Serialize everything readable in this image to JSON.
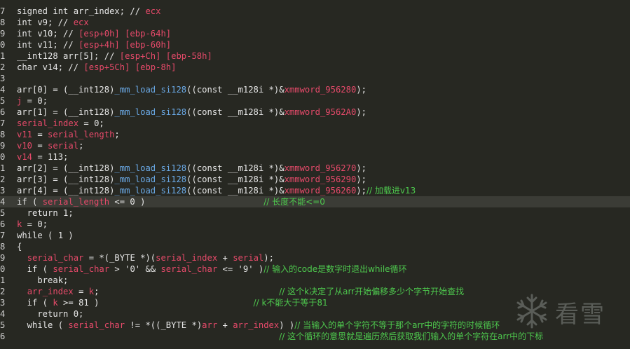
{
  "editor": {
    "lines": [
      {
        "ln": "7",
        "hl": false,
        "tokens": [
          {
            "t": "signed int arr_index; // "
          },
          {
            "t": "ecx",
            "c": "cmt"
          }
        ]
      },
      {
        "ln": "8",
        "hl": false,
        "tokens": [
          {
            "t": "int v9; // "
          },
          {
            "t": "ecx",
            "c": "cmt"
          }
        ]
      },
      {
        "ln": "9",
        "hl": false,
        "tokens": [
          {
            "t": "int v10; // "
          },
          {
            "t": "[esp+0h] [ebp-64h]",
            "c": "cmt"
          }
        ]
      },
      {
        "ln": "0",
        "hl": false,
        "tokens": [
          {
            "t": "int v11; // "
          },
          {
            "t": "[esp+4h] [ebp-60h]",
            "c": "cmt"
          }
        ]
      },
      {
        "ln": "1",
        "hl": false,
        "tokens": [
          {
            "t": "__int128 arr[5]; // "
          },
          {
            "t": "[esp+Ch] [ebp-58h]",
            "c": "cmt"
          }
        ]
      },
      {
        "ln": "2",
        "hl": false,
        "tokens": [
          {
            "t": "char v14; // "
          },
          {
            "t": "[esp+5Ch] [ebp-8h]",
            "c": "cmt"
          }
        ]
      },
      {
        "ln": "3",
        "hl": false,
        "tokens": []
      },
      {
        "ln": "4",
        "hl": false,
        "tokens": [
          {
            "t": "arr[0] = (__int128)"
          },
          {
            "t": "_mm_load_si128",
            "c": "fn"
          },
          {
            "t": "((const __m128i *)&"
          },
          {
            "t": "xmmword_956280",
            "c": "var"
          },
          {
            "t": ");"
          }
        ]
      },
      {
        "ln": "5",
        "hl": false,
        "tokens": [
          {
            "t": "j",
            "c": "var"
          },
          {
            "t": " = 0;"
          }
        ]
      },
      {
        "ln": "6",
        "hl": false,
        "tokens": [
          {
            "t": "arr[1] = (__int128)"
          },
          {
            "t": "_mm_load_si128",
            "c": "fn"
          },
          {
            "t": "((const __m128i *)&"
          },
          {
            "t": "xmmword_9562A0",
            "c": "var"
          },
          {
            "t": ");"
          }
        ]
      },
      {
        "ln": "7",
        "hl": false,
        "tokens": [
          {
            "t": "serial_index",
            "c": "var"
          },
          {
            "t": " = 0;"
          }
        ]
      },
      {
        "ln": "8",
        "hl": false,
        "tokens": [
          {
            "t": "v11",
            "c": "var"
          },
          {
            "t": " = "
          },
          {
            "t": "serial_length",
            "c": "var"
          },
          {
            "t": ";"
          }
        ]
      },
      {
        "ln": "9",
        "hl": false,
        "tokens": [
          {
            "t": "v10",
            "c": "var"
          },
          {
            "t": " = "
          },
          {
            "t": "serial",
            "c": "var"
          },
          {
            "t": ";"
          }
        ]
      },
      {
        "ln": "0",
        "hl": false,
        "tokens": [
          {
            "t": "v14",
            "c": "var"
          },
          {
            "t": " = 113;"
          }
        ]
      },
      {
        "ln": "1",
        "hl": false,
        "tokens": [
          {
            "t": "arr[2] = (__int128)"
          },
          {
            "t": "_mm_load_si128",
            "c": "fn"
          },
          {
            "t": "((const __m128i *)&"
          },
          {
            "t": "xmmword_956270",
            "c": "var"
          },
          {
            "t": ");"
          }
        ]
      },
      {
        "ln": "2",
        "hl": false,
        "tokens": [
          {
            "t": "arr[3] = (__int128)"
          },
          {
            "t": "_mm_load_si128",
            "c": "fn"
          },
          {
            "t": "((const __m128i *)&"
          },
          {
            "t": "xmmword_956290",
            "c": "var"
          },
          {
            "t": ");"
          }
        ]
      },
      {
        "ln": "3",
        "hl": false,
        "tokens": [
          {
            "t": "arr[4] = (__int128)"
          },
          {
            "t": "_mm_load_si128",
            "c": "fn"
          },
          {
            "t": "((const __m128i *)&"
          },
          {
            "t": "xmmword_956260",
            "c": "var"
          },
          {
            "t": ");"
          },
          {
            "t": "// 加载进v13",
            "c": "zh"
          }
        ]
      },
      {
        "ln": "4",
        "hl": true,
        "tokens": [
          {
            "t": "if ( "
          },
          {
            "t": "serial_length",
            "c": "var"
          },
          {
            "t": " <= 0 )                       "
          },
          {
            "t": "// 长度不能<=0",
            "c": "zh"
          }
        ]
      },
      {
        "ln": "5",
        "hl": false,
        "tokens": [
          {
            "t": "  return 1;"
          }
        ]
      },
      {
        "ln": "6",
        "hl": false,
        "tokens": [
          {
            "t": "k",
            "c": "var"
          },
          {
            "t": " = 0;"
          }
        ]
      },
      {
        "ln": "7",
        "hl": false,
        "tokens": [
          {
            "t": "while ( 1 )"
          }
        ]
      },
      {
        "ln": "8",
        "hl": false,
        "tokens": [
          {
            "t": "{"
          }
        ]
      },
      {
        "ln": "9",
        "hl": false,
        "tokens": [
          {
            "t": "  "
          },
          {
            "t": "serial_char",
            "c": "var"
          },
          {
            "t": " = *(_BYTE *)("
          },
          {
            "t": "serial_index",
            "c": "var"
          },
          {
            "t": " + "
          },
          {
            "t": "serial",
            "c": "var"
          },
          {
            "t": ");"
          }
        ]
      },
      {
        "ln": "0",
        "hl": false,
        "tokens": [
          {
            "t": "  if ( "
          },
          {
            "t": "serial_char",
            "c": "var"
          },
          {
            "t": " > '0' && "
          },
          {
            "t": "serial_char",
            "c": "var"
          },
          {
            "t": " <= '9' )"
          },
          {
            "t": "// 输入的code是数字时退出while循环",
            "c": "zh"
          }
        ]
      },
      {
        "ln": "1",
        "hl": false,
        "tokens": [
          {
            "t": "    break;"
          }
        ]
      },
      {
        "ln": "2",
        "hl": false,
        "tokens": [
          {
            "t": "  "
          },
          {
            "t": "arr_index",
            "c": "var"
          },
          {
            "t": " = "
          },
          {
            "t": "k",
            "c": "var"
          },
          {
            "t": ";                                   "
          },
          {
            "t": "// 这个k决定了从arr开始偏移多少个字节开始查找",
            "c": "zh"
          }
        ]
      },
      {
        "ln": "3",
        "hl": false,
        "tokens": [
          {
            "t": "  if ( "
          },
          {
            "t": "k",
            "c": "var"
          },
          {
            "t": " >= 81 )                              "
          },
          {
            "t": "// k不能大于等于81",
            "c": "zh"
          }
        ]
      },
      {
        "ln": "4",
        "hl": false,
        "tokens": [
          {
            "t": "    return 0;"
          }
        ]
      },
      {
        "ln": "5",
        "hl": false,
        "tokens": [
          {
            "t": "  while ( "
          },
          {
            "t": "serial_char",
            "c": "var"
          },
          {
            "t": " != *((_BYTE *)"
          },
          {
            "t": "arr",
            "c": "var"
          },
          {
            "t": " + "
          },
          {
            "t": "arr_index",
            "c": "var"
          },
          {
            "t": ") )"
          },
          {
            "t": "// 当输入的单个字符不等于那个arr中的字符的时候循环",
            "c": "zh"
          }
        ]
      },
      {
        "ln": "6",
        "hl": false,
        "tokens": [
          {
            "t": "                                                   "
          },
          {
            "t": "// 这个循环的意思就是遍历然后获取我们输入的单个字符在arr中的下标",
            "c": "zh"
          }
        ]
      }
    ]
  },
  "watermark": {
    "text": "看雪",
    "icon": "snowflake-icon",
    "color": "#5a5d58"
  },
  "colors": {
    "background": "#272822",
    "highlight_line": "#3b3c36",
    "variable": "#e64a6a",
    "function": "#6aa9e6",
    "comment_zh": "#4ec94e",
    "text": "#e6e6e6"
  }
}
